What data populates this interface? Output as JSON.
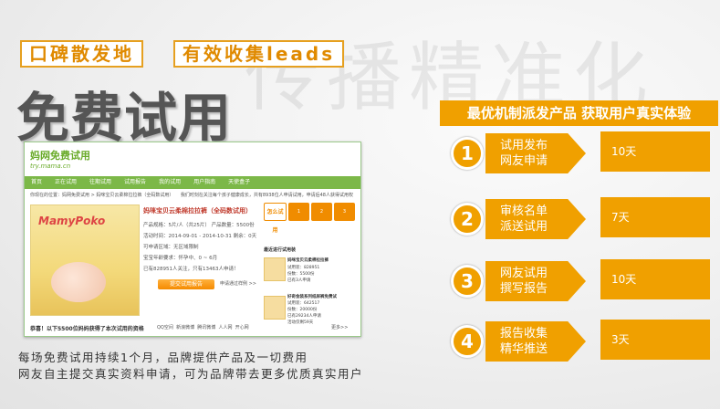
{
  "watermark": "传播精准化",
  "tags": [
    "口碑散发地",
    "有效收集leads"
  ],
  "main_title": "免费试用",
  "screenshot": {
    "logo": {
      "cn": "妈网免费试用",
      "url": "try.mama.cn"
    },
    "nav": [
      "首页",
      "正在试用",
      "往期试用",
      "试用报告",
      "我的试用",
      "用户指南",
      "天使盒子"
    ],
    "breadcrumb": "你现在的位置：妈网免费试用 > 妈咪宝贝云柔棉拉拉裤（全码数试用）　　我们时刻在关注每个孩子健康成长，共有8938位人申请试用，申请后48人获得试用权",
    "product": {
      "brand": "MamyPoko",
      "title": "妈咪宝贝云柔棉拉拉裤（全码数试用）",
      "lines": [
        "产品规格：5片/人（共25片） 产品数量：5500份",
        "活动时间：2014-09-01 - 2014-10-31 剩余：0天",
        "可申请区域：无区域限制",
        "宝宝年龄要求：怀孕中、0 ~ 6月",
        "已有828951人关注，只有13463人申请！"
      ],
      "apply_label": "提交试用报告",
      "example_label": "申请通过样例 >>"
    },
    "steps": [
      "怎么试用",
      "1",
      "2",
      "3"
    ],
    "recent_title": "最近进行试用装",
    "recent_items": [
      {
        "name": "妈咪宝贝云柔棉拉拉裤",
        "l1": "试用装：828951",
        "l2": "份数：5500份",
        "l3": "已有3人申请"
      },
      {
        "name": "好奇金装系列纸尿裤免费试",
        "l1": "试用装：642517",
        "l2": "份数：20000份",
        "l3": "已有29234人申请",
        "l4": "活动仅剩59天"
      }
    ],
    "notice": "恭喜！以下5500位妈妈获得了本次试用的资格",
    "shares": [
      "QQ空间",
      "新浪微博",
      "腾讯微博",
      "人人网",
      "开心网"
    ],
    "more": "更多>>"
  },
  "caption_lines": [
    "每场免费试用持续1个月，品牌提供产品及一切费用",
    "网友自主提交真实资料申请，可为品牌带去更多优质真实用户"
  ],
  "banner": "最优机制派发产品 获取用户真实体验",
  "process": [
    {
      "num": "1",
      "label": [
        "试用发布",
        "网友申请"
      ],
      "duration": "10天"
    },
    {
      "num": "2",
      "label": [
        "审核名单",
        "派送试用"
      ],
      "duration": "7天"
    },
    {
      "num": "3",
      "label": [
        "网友试用",
        "撰写报告"
      ],
      "duration": "10天"
    },
    {
      "num": "4",
      "label": [
        "报告收集",
        "精华推送"
      ],
      "duration": "3天"
    }
  ]
}
